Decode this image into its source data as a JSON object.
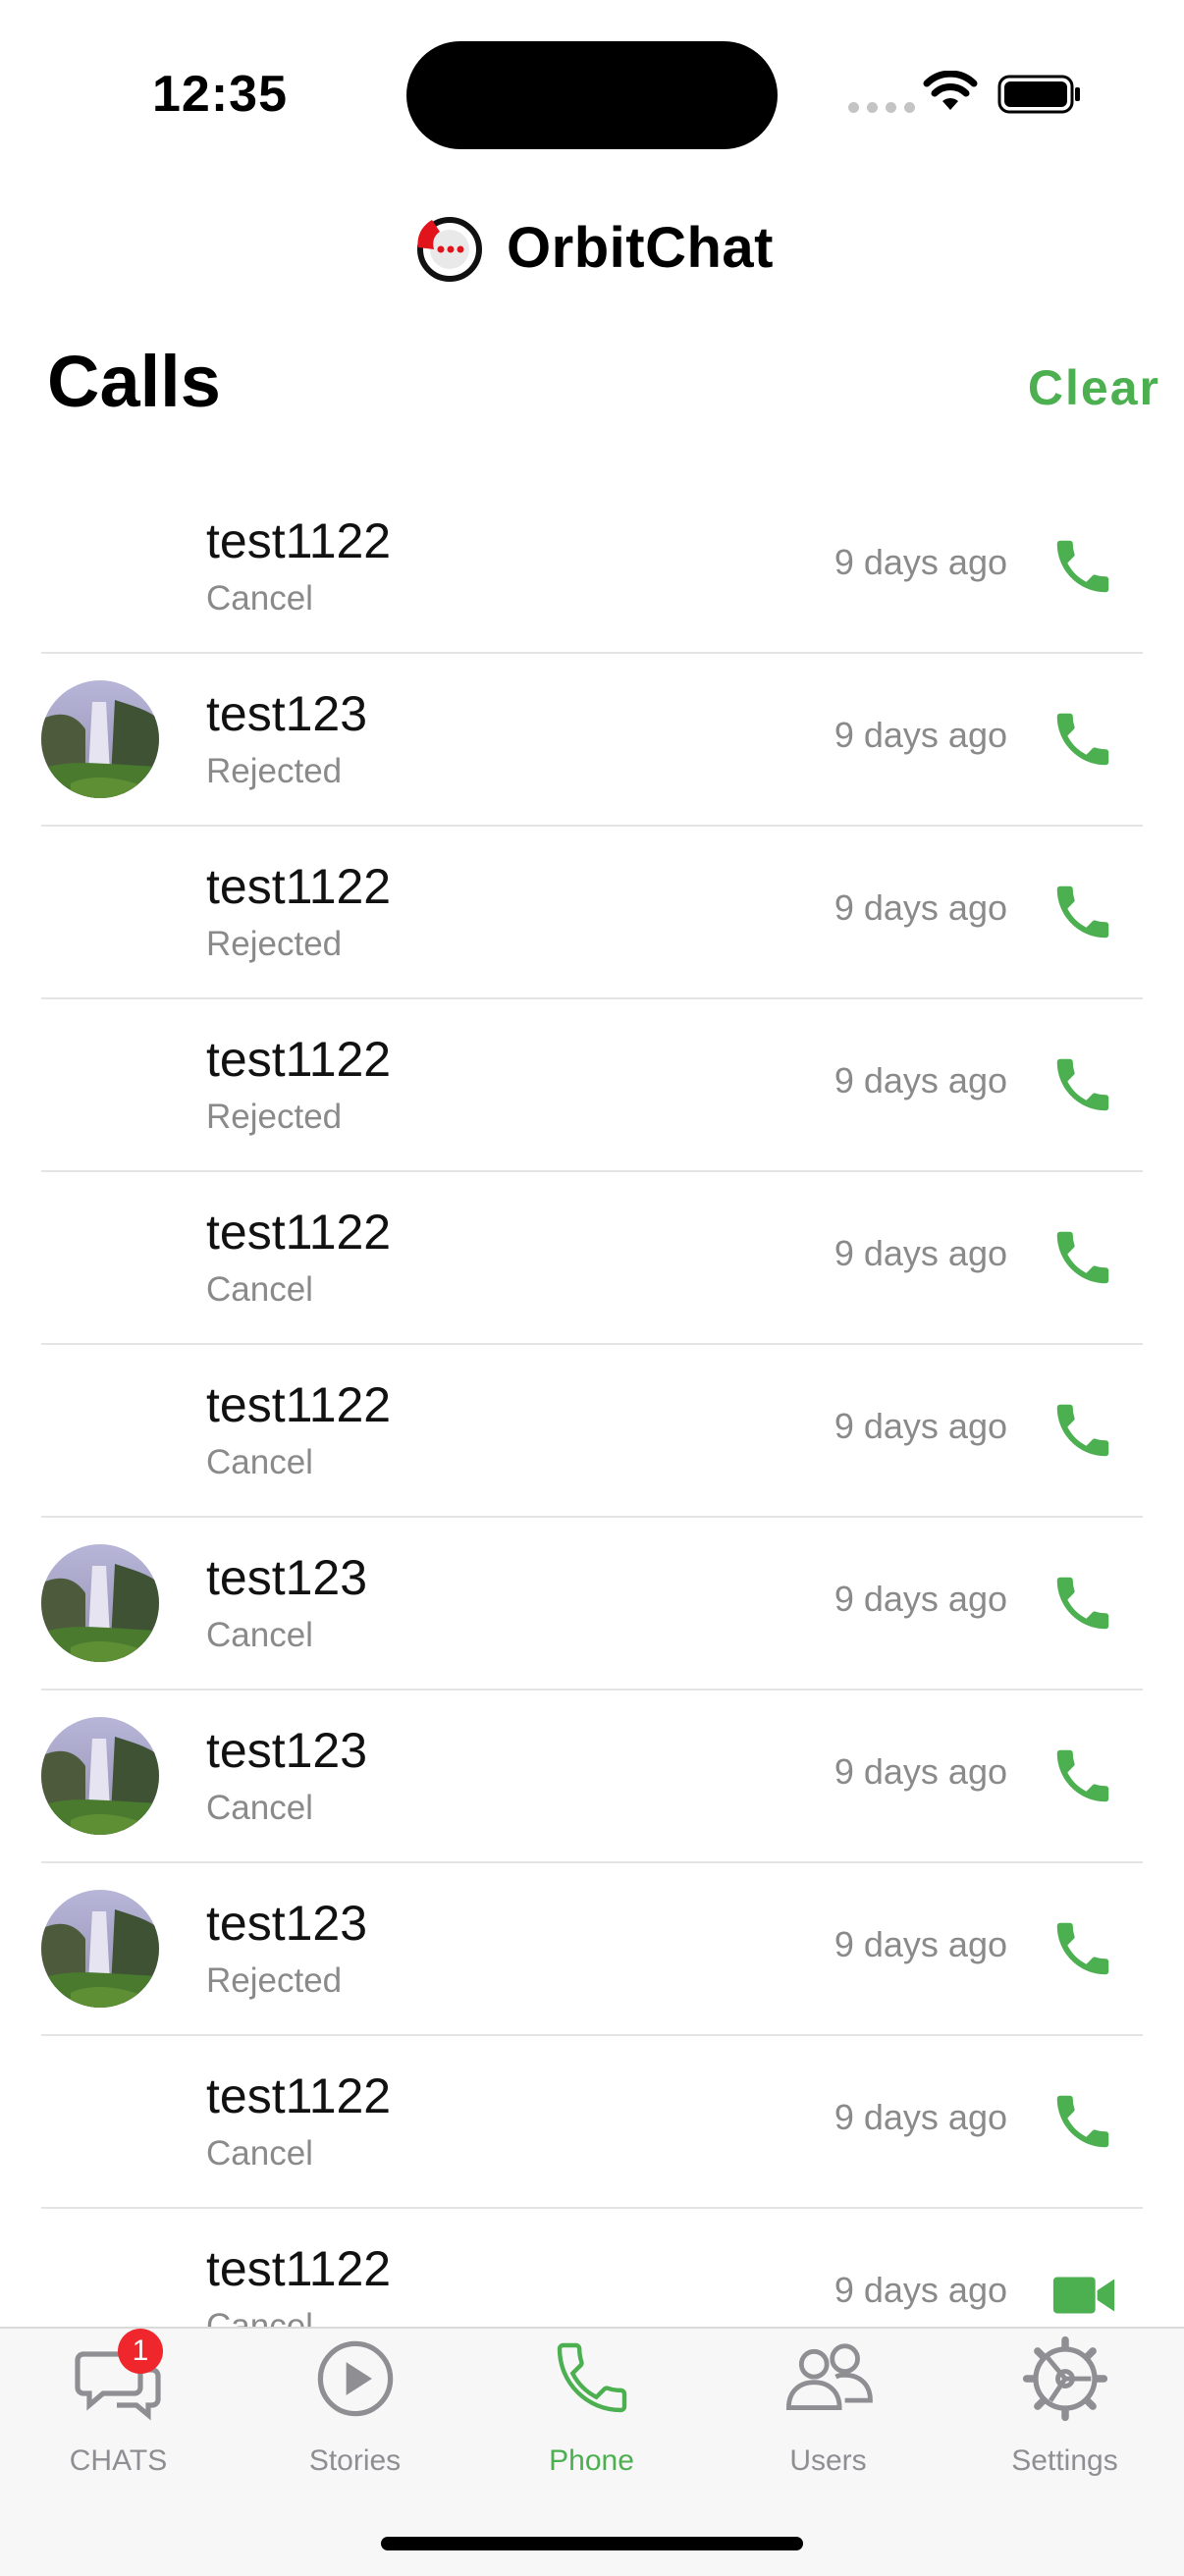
{
  "status_bar": {
    "time": "12:35"
  },
  "header": {
    "app_name": "OrbitChat",
    "logo_icon": "orbit-phone-logo-icon"
  },
  "page": {
    "title": "Calls",
    "clear_label": "Clear"
  },
  "calls": [
    {
      "name": "test1122",
      "status": "Cancel",
      "time": "9 days ago",
      "avatar": false,
      "type": "audio"
    },
    {
      "name": "test123",
      "status": "Rejected",
      "time": "9 days ago",
      "avatar": true,
      "type": "audio"
    },
    {
      "name": "test1122",
      "status": "Rejected",
      "time": "9 days ago",
      "avatar": false,
      "type": "audio"
    },
    {
      "name": "test1122",
      "status": "Rejected",
      "time": "9 days ago",
      "avatar": false,
      "type": "audio"
    },
    {
      "name": "test1122",
      "status": "Cancel",
      "time": "9 days ago",
      "avatar": false,
      "type": "audio"
    },
    {
      "name": "test1122",
      "status": "Cancel",
      "time": "9 days ago",
      "avatar": false,
      "type": "audio"
    },
    {
      "name": "test123",
      "status": "Cancel",
      "time": "9 days ago",
      "avatar": true,
      "type": "audio"
    },
    {
      "name": "test123",
      "status": "Cancel",
      "time": "9 days ago",
      "avatar": true,
      "type": "audio"
    },
    {
      "name": "test123",
      "status": "Rejected",
      "time": "9 days ago",
      "avatar": true,
      "type": "audio"
    },
    {
      "name": "test1122",
      "status": "Cancel",
      "time": "9 days ago",
      "avatar": false,
      "type": "audio"
    },
    {
      "name": "test1122",
      "status": "Cancel",
      "time": "9 days ago",
      "avatar": false,
      "type": "video"
    }
  ],
  "tabs": [
    {
      "label": "CHATS",
      "icon": "chat-bubbles-icon",
      "badge": "1",
      "active": false
    },
    {
      "label": "Stories",
      "icon": "play-circle-icon",
      "active": false
    },
    {
      "label": "Phone",
      "icon": "phone-icon",
      "active": true
    },
    {
      "label": "Users",
      "icon": "users-icon",
      "active": false
    },
    {
      "label": "Settings",
      "icon": "gear-icon",
      "active": false
    }
  ],
  "colors": {
    "accent": "#4caf50",
    "badge": "#f0262d",
    "muted": "#8a8a8a"
  }
}
